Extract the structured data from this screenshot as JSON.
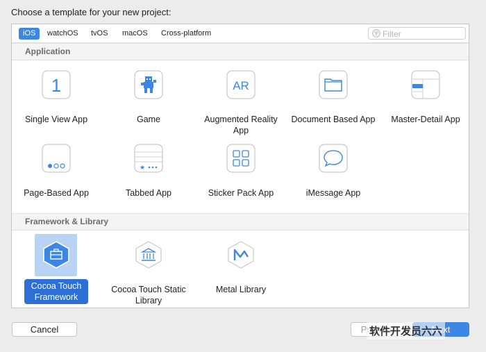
{
  "dialog": {
    "prompt": "Choose a template for your new project:"
  },
  "tabs": [
    {
      "label": "iOS",
      "selected": true
    },
    {
      "label": "watchOS",
      "selected": false
    },
    {
      "label": "tvOS",
      "selected": false
    },
    {
      "label": "macOS",
      "selected": false
    },
    {
      "label": "Cross-platform",
      "selected": false
    }
  ],
  "filter": {
    "placeholder": "Filter",
    "icon": "filter-icon"
  },
  "sections": [
    {
      "title": "Application",
      "items": [
        {
          "label": "Single View App",
          "icon": "single-view-app-icon"
        },
        {
          "label": "Game",
          "icon": "game-icon"
        },
        {
          "label": "Augmented Reality App",
          "icon": "augmented-reality-icon"
        },
        {
          "label": "Document Based App",
          "icon": "document-based-icon"
        },
        {
          "label": "Master-Detail App",
          "icon": "master-detail-icon"
        },
        {
          "label": "Page-Based App",
          "icon": "page-based-icon"
        },
        {
          "label": "Tabbed App",
          "icon": "tabbed-app-icon"
        },
        {
          "label": "Sticker Pack App",
          "icon": "sticker-pack-icon"
        },
        {
          "label": "iMessage App",
          "icon": "imessage-icon"
        }
      ]
    },
    {
      "title": "Framework & Library",
      "items": [
        {
          "label": "Cocoa Touch Framework",
          "icon": "cocoa-touch-framework-icon",
          "selected": true
        },
        {
          "label": "Cocoa Touch Static Library",
          "icon": "cocoa-touch-static-library-icon"
        },
        {
          "label": "Metal Library",
          "icon": "metal-library-icon"
        }
      ]
    }
  ],
  "buttons": {
    "cancel": "Cancel",
    "previous": "Previous",
    "next": "Next"
  },
  "watermark": "软件开发员六六",
  "colors": {
    "accent": "#3c86e6",
    "selection": "#2e6fd6",
    "icon_blue": "#3c86e6"
  }
}
